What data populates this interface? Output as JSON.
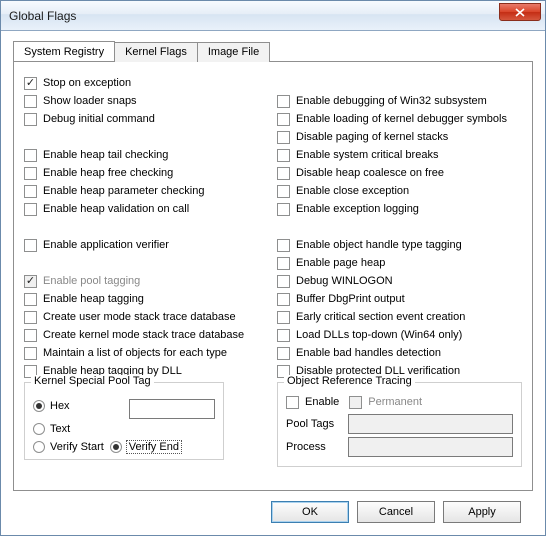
{
  "window": {
    "title": "Global Flags"
  },
  "tabs": [
    {
      "label": "System Registry",
      "active": true
    },
    {
      "label": "Kernel Flags",
      "active": false
    },
    {
      "label": "Image File",
      "active": false
    }
  ],
  "left_section_a": [
    {
      "label": "Stop on exception",
      "checked": true
    },
    {
      "label": "Show loader snaps",
      "checked": false
    },
    {
      "label": "Debug initial command",
      "checked": false
    }
  ],
  "left_section_b": [
    {
      "label": "Enable heap tail checking",
      "checked": false
    },
    {
      "label": "Enable heap free checking",
      "checked": false
    },
    {
      "label": "Enable heap parameter checking",
      "checked": false
    },
    {
      "label": "Enable heap validation on call",
      "checked": false
    }
  ],
  "left_section_c": [
    {
      "label": "Enable application verifier",
      "checked": false
    }
  ],
  "left_section_d": [
    {
      "label": "Enable pool tagging",
      "checked": true,
      "disabled": true
    },
    {
      "label": "Enable heap tagging",
      "checked": false
    },
    {
      "label": "Create user mode stack trace database",
      "checked": false
    },
    {
      "label": "Create kernel mode stack trace database",
      "checked": false
    },
    {
      "label": "Maintain a list of objects for each type",
      "checked": false
    },
    {
      "label": "Enable heap tagging by DLL",
      "checked": false
    }
  ],
  "right_section_a": [
    {
      "label": "Enable debugging of Win32 subsystem",
      "checked": false
    },
    {
      "label": "Enable loading of kernel debugger symbols",
      "checked": false
    },
    {
      "label": "Disable paging of kernel stacks",
      "checked": false
    },
    {
      "label": "Enable system critical breaks",
      "checked": false
    },
    {
      "label": "Disable heap coalesce on free",
      "checked": false
    },
    {
      "label": "Enable close exception",
      "checked": false
    },
    {
      "label": "Enable exception logging",
      "checked": false
    }
  ],
  "right_section_b": [
    {
      "label": "Enable object handle type tagging",
      "checked": false
    },
    {
      "label": "Enable page heap",
      "checked": false
    },
    {
      "label": "Debug WINLOGON",
      "checked": false
    },
    {
      "label": "Buffer DbgPrint output",
      "checked": false
    },
    {
      "label": "Early critical section event creation",
      "checked": false
    },
    {
      "label": "Load DLLs top-down (Win64 only)",
      "checked": false
    },
    {
      "label": "Enable bad handles detection",
      "checked": false
    },
    {
      "label": "Disable protected DLL verification",
      "checked": false
    }
  ],
  "kernel_pool_tag": {
    "legend": "Kernel Special Pool Tag",
    "hex_label": "Hex",
    "text_label": "Text",
    "verify_start_label": "Verify Start",
    "verify_end_label": "Verify End",
    "mode": "hex",
    "verify": "end",
    "value": ""
  },
  "object_ref_tracing": {
    "legend": "Object Reference Tracing",
    "enable_label": "Enable",
    "permanent_label": "Permanent",
    "pool_tags_label": "Pool Tags",
    "process_label": "Process",
    "enable": false,
    "permanent": false,
    "pool_tags": "",
    "process": ""
  },
  "buttons": {
    "ok": "OK",
    "cancel": "Cancel",
    "apply": "Apply"
  }
}
